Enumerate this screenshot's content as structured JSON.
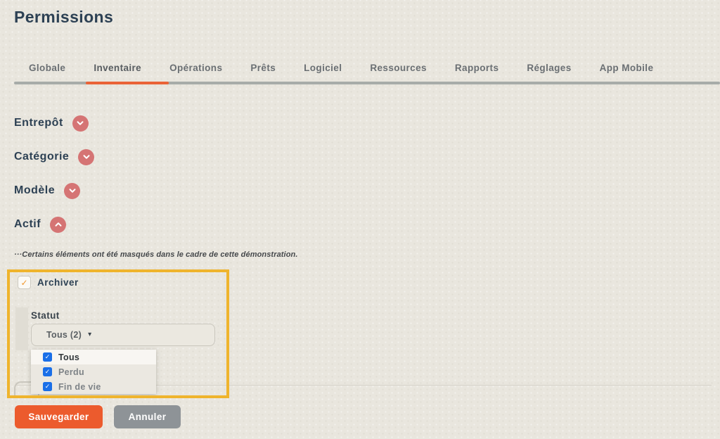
{
  "page": {
    "title": "Permissions"
  },
  "tabs": [
    {
      "label": "Globale"
    },
    {
      "label": "Inventaire"
    },
    {
      "label": "Opérations"
    },
    {
      "label": "Prêts"
    },
    {
      "label": "Logiciel"
    },
    {
      "label": "Ressources"
    },
    {
      "label": "Rapports"
    },
    {
      "label": "Réglages"
    },
    {
      "label": "App Mobile"
    }
  ],
  "active_tab": "Inventaire",
  "sections": [
    {
      "label": "Entrepôt",
      "icon": "chevron-down-icon",
      "expanded": false
    },
    {
      "label": "Catégorie",
      "icon": "chevron-down-icon",
      "expanded": false
    },
    {
      "label": "Modèle",
      "icon": "chevron-down-icon",
      "expanded": false
    },
    {
      "label": "Actif",
      "icon": "chevron-up-icon",
      "expanded": true
    }
  ],
  "note": "···Certains éléments ont été masqués dans le cadre de cette démonstration.",
  "actif_panel": {
    "archive": {
      "label": "Archiver",
      "checked": true,
      "checkmark": "✓"
    },
    "statut": {
      "label": "Statut",
      "value": "Tous (2)",
      "caret": "▾",
      "options": [
        {
          "label": "Tous",
          "checked": true,
          "highlighted": true
        },
        {
          "label": "Perdu",
          "checked": true,
          "highlighted": false
        },
        {
          "label": "Fin de vie",
          "checked": true,
          "highlighted": false
        }
      ]
    }
  },
  "actions": {
    "save": "Sauvegarder",
    "cancel": "Annuler"
  },
  "colors": {
    "page_background": "#e9e6de",
    "title_text": "#2d4154",
    "tab_text": "#6a6f73",
    "tab_track": "#a7aca9",
    "tab_active_underline": "#ea6337",
    "chevron_badge": "#d57474",
    "annotation_border": "#efb42d",
    "archive_check_orange": "#f0982f",
    "checkbox_blue": "#1a6fe8",
    "save_button": "#ec5b2d",
    "cancel_button": "#8e9397"
  }
}
